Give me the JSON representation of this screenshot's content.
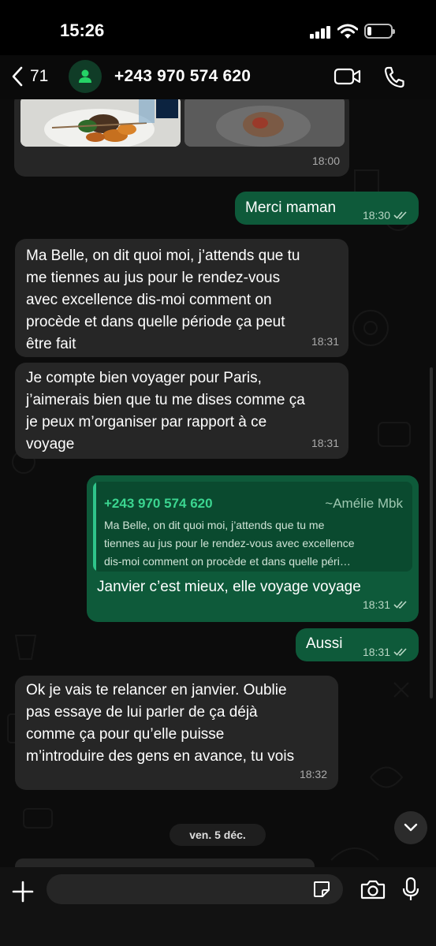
{
  "status_bar": {
    "time": "15:26"
  },
  "header": {
    "back_count": "71",
    "contact_name": "+243 970 574 620"
  },
  "messages": [
    {
      "id": "m0",
      "type": "photo",
      "direction": "in",
      "time": "18:00"
    },
    {
      "id": "m1",
      "direction": "out",
      "text": "Merci maman",
      "time": "18:30",
      "read": true
    },
    {
      "id": "m2",
      "direction": "in",
      "lines": [
        "Ma Belle, on dit quoi moi, j’attends que tu",
        "me tiennes au jus pour le rendez-vous",
        "avec excellence dis-moi comment on",
        "procède et dans quelle période ça peut",
        "être fait"
      ],
      "time": "18:31"
    },
    {
      "id": "m3",
      "direction": "in",
      "lines": [
        "Je compte bien voyager pour Paris,",
        "j’aimerais bien que tu me dises comme ça",
        "je peux m’organiser par rapport à ce",
        "voyage"
      ],
      "time": "18:31"
    },
    {
      "id": "m4",
      "direction": "out",
      "quote": {
        "name": "+243 970 574 620",
        "alias": "~Amélie Mbk",
        "lines": [
          "Ma Belle, on dit quoi moi, j’attends que tu me",
          "tiennes au jus pour le rendez-vous avec excellence",
          "dis-moi comment on procède et dans quelle péri…"
        ]
      },
      "text": "Janvier c’est mieux, elle voyage voyage",
      "time": "18:31",
      "read": true
    },
    {
      "id": "m5",
      "direction": "out",
      "text": "Aussi",
      "time": "18:31",
      "read": true
    },
    {
      "id": "m6",
      "direction": "in",
      "lines": [
        "Ok je vais te relancer en janvier. Oublie",
        "pas essaye de lui parler de ça déjà",
        "comme ça pour qu’elle puisse",
        "m’introduire des gens en avance, tu vois"
      ],
      "time": "18:32"
    }
  ],
  "date_separator": "ven. 5 déc.",
  "input": {
    "placeholder": ""
  },
  "colors": {
    "incoming_bubble": "#262626",
    "outgoing_bubble": "#0e5a3a",
    "accent": "#25d366",
    "read_ticks": "#b8d6c4"
  },
  "icons": [
    "back-chevron-icon",
    "person-icon",
    "video-call-icon",
    "phone-icon",
    "plus-icon",
    "sticker-icon",
    "camera-icon",
    "microphone-icon",
    "chevron-down-icon",
    "read-ticks-icon"
  ]
}
